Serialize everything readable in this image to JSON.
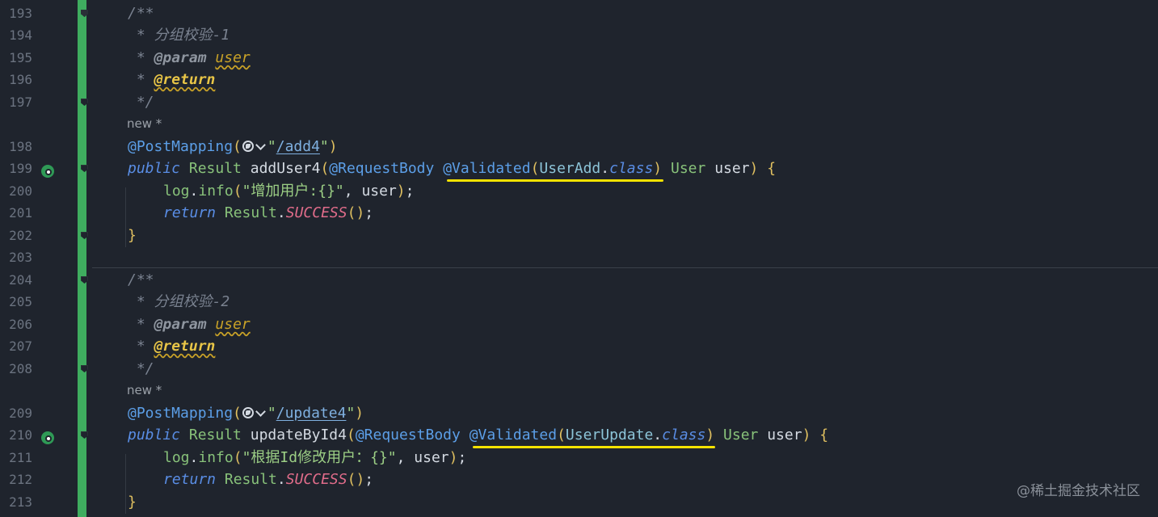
{
  "editor": {
    "line_numbers": [
      "193",
      "194",
      "195",
      "196",
      "197",
      "198",
      "199",
      "200",
      "201",
      "202",
      "203",
      "204",
      "205",
      "206",
      "207",
      "208",
      "209",
      "210",
      "211",
      "212",
      "213"
    ],
    "block1": {
      "comment_open": "/**",
      "comment_desc": " * 分组校验-1",
      "comment_star": " * ",
      "param_tag": "@param",
      "param_name": "user",
      "return_tag": "@return",
      "comment_close": " */",
      "inlay_new": "new *",
      "post_mapping": "@PostMapping",
      "open_paren": "(",
      "url": "/add4",
      "quote": "\"",
      "close_paren": ")",
      "kw_public": "public",
      "type_result": "Result",
      "method_name": "addUser4",
      "ann_request_body": "@RequestBody",
      "ann_validated": "@Validated",
      "group_class": "UserAdd",
      "dot": ".",
      "kw_class": "class",
      "type_user": "User",
      "param_user": "user",
      "open_brace": "{",
      "log": "log",
      "info": "info",
      "log_str": "\"增加用户:{}\"",
      "comma": ", ",
      "semicolon": ";",
      "kw_return": "return",
      "success": "SUCCESS",
      "call_parens": "()",
      "close_brace": "}"
    },
    "block2": {
      "comment_open": "/**",
      "comment_desc": " * 分组校验-2",
      "comment_star": " * ",
      "param_tag": "@param",
      "param_name": "user",
      "return_tag": "@return",
      "comment_close": " */",
      "inlay_new": "new *",
      "post_mapping": "@PostMapping",
      "open_paren": "(",
      "url": "/update4",
      "quote": "\"",
      "close_paren": ")",
      "kw_public": "public",
      "type_result": "Result",
      "method_name": "updateById4",
      "ann_request_body": "@RequestBody",
      "ann_validated": "@Validated",
      "group_class": "UserUpdate",
      "dot": ".",
      "kw_class": "class",
      "type_user": "User",
      "param_user": "user",
      "open_brace": "{",
      "log": "log",
      "info": "info",
      "log_str": "\"根据Id修改用户：{}\"",
      "comma": ", ",
      "semicolon": ";",
      "kw_return": "return",
      "success": "SUCCESS",
      "call_parens": "()",
      "close_brace": "}"
    }
  },
  "gutter_icons": {
    "run_icon": "endpoint-globe-run-icon",
    "fold_icon": "fold-marker-icon",
    "url_icon": "globe-icon"
  },
  "colors": {
    "background": "#1f242d",
    "vcs_added": "#3fad5f",
    "highlight_underline": "#f5e200"
  },
  "watermark": "@稀土掘金技术社区"
}
